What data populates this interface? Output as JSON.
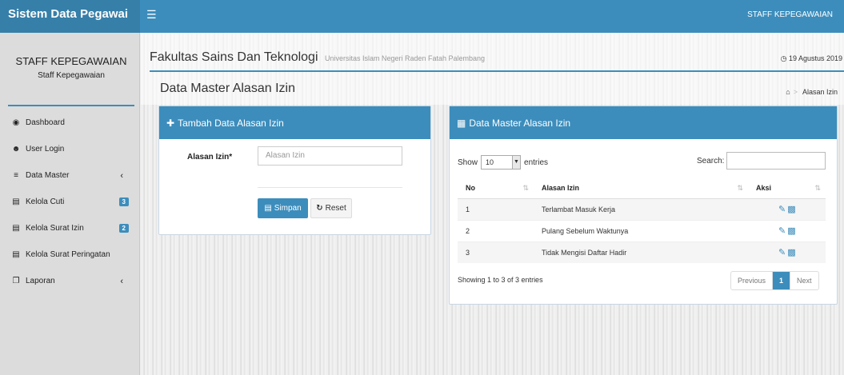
{
  "app": {
    "brand": "Sistem Data Pegawai",
    "top_user": "STAFF KEPEGAWAIAN"
  },
  "sidebar": {
    "user_name": "STAFF KEPEGAWAIAN",
    "user_role": "Staff Kepegawaian",
    "items": [
      {
        "label": "Dashboard",
        "icon": "dashboard-icon"
      },
      {
        "label": "User Login",
        "icon": "users-icon"
      },
      {
        "label": "Data Master",
        "icon": "list-icon",
        "caret": "‹"
      },
      {
        "label": "Kelola Cuti",
        "icon": "card-icon",
        "badge": "3"
      },
      {
        "label": "Kelola Surat Izin",
        "icon": "card-icon",
        "badge": "2"
      },
      {
        "label": "Kelola Surat Peringatan",
        "icon": "card-icon"
      },
      {
        "label": "Laporan",
        "icon": "copy-icon",
        "caret": "‹"
      }
    ]
  },
  "header": {
    "institution": "Fakultas Sains Dan Teknologi",
    "institution_sub": "Universitas Islam Negeri Raden Fatah Palembang",
    "date": "19 Agustus 2019",
    "page_title": "Data Master Alasan Izin",
    "breadcrumb": "Alasan Izin"
  },
  "form": {
    "title": "Tambah Data Alasan Izin",
    "label": "Alasan Izin*",
    "placeholder": "Alasan Izin",
    "save": "Simpan",
    "reset": "Reset"
  },
  "table": {
    "title": "Data Master Alasan Izin",
    "show": "Show",
    "length": "10",
    "entries": "entries",
    "search_label": "Search:",
    "columns": [
      "No",
      "Alasan Izin",
      "Aksi"
    ],
    "rows": [
      {
        "no": "1",
        "alasan": "Terlambat Masuk Kerja"
      },
      {
        "no": "2",
        "alasan": "Pulang Sebelum Waktunya"
      },
      {
        "no": "3",
        "alasan": "Tidak Mengisi Daftar Hadir"
      }
    ],
    "info": "Showing 1 to 3 of 3 entries",
    "prev": "Previous",
    "page": "1",
    "next": "Next"
  }
}
